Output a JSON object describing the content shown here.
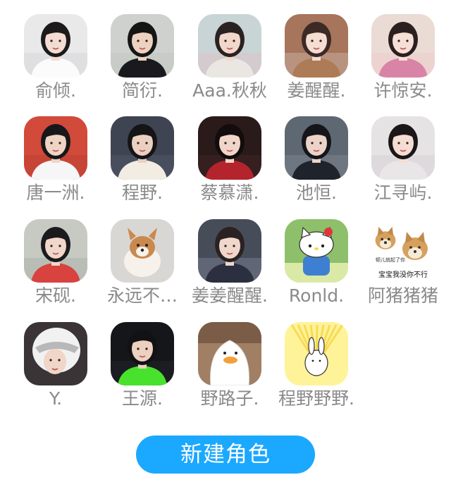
{
  "roles": [
    {
      "name": "俞倾.",
      "avatar": {
        "bg": "#e9e9ea",
        "skin": "#f3dcd2",
        "hair": "#1c1a1b",
        "cloth": "#fbfbfb",
        "accent": "#cfcfd2"
      }
    },
    {
      "name": "简衍.",
      "avatar": {
        "bg": "#cfd1cf",
        "skin": "#ecd2bf",
        "hair": "#151515",
        "cloth": "#1a1a1e",
        "accent": "#b7c2b8"
      }
    },
    {
      "name": "Aaa.秋秋",
      "avatar": {
        "bg": "#c9d4d6",
        "skin": "#f1d8cb",
        "hair": "#2a2221",
        "cloth": "#eae7e2",
        "accent": "#e9b9c0"
      }
    },
    {
      "name": "姜醒醒.",
      "avatar": {
        "bg": "#a7745c",
        "skin": "#f5ddd1",
        "hair": "#3b2a25",
        "cloth": "#ad7b56",
        "accent": "#d9cfc4"
      }
    },
    {
      "name": "许惊安.",
      "avatar": {
        "bg": "#eadbd5",
        "skin": "#f6dfd6",
        "hair": "#2b1f1f",
        "cloth": "#d984a6",
        "accent": "#f2c7c9"
      }
    },
    {
      "name": "唐一洲.",
      "avatar": {
        "bg": "#d24a3a",
        "skin": "#efd4c3",
        "hair": "#18171a",
        "cloth": "#f6f6f6",
        "accent": "#b43b30"
      }
    },
    {
      "name": "程野.",
      "avatar": {
        "bg": "#3f4452",
        "skin": "#ebd0c1",
        "hair": "#151417",
        "cloth": "#f2ece2",
        "accent": "#5a6276"
      }
    },
    {
      "name": "蔡慕潇.",
      "avatar": {
        "bg": "#2a1a1a",
        "skin": "#f0d5c8",
        "hair": "#120c0c",
        "cloth": "#b3242d",
        "accent": "#4a2b2b"
      }
    },
    {
      "name": "池恒.",
      "avatar": {
        "bg": "#5e6873",
        "skin": "#ecd3c7",
        "hair": "#15151a",
        "cloth": "#1f232b",
        "accent": "#8a939c"
      }
    },
    {
      "name": "江寻屿.",
      "avatar": {
        "bg": "#e6e3e5",
        "skin": "#f5ddd3",
        "hair": "#1b1617",
        "cloth": "#e8e6e7",
        "accent": "#cbc7cb"
      }
    },
    {
      "name": "宋砚.",
      "avatar": {
        "bg": "#c7cac3",
        "skin": "#f0d7c9",
        "hair": "#1b1a1c",
        "cloth": "#d8423f",
        "accent": "#9fa79a"
      }
    },
    {
      "name": "永远不…",
      "avatar": {
        "bg": "#d9d7d4",
        "skin": "#c9894f",
        "hair": "#f6f1ea",
        "cloth": "#e7e4e0",
        "accent": "#a8a6a3"
      }
    },
    {
      "name": "姜姜醒醒.",
      "avatar": {
        "bg": "#474c59",
        "skin": "#f0d7cc",
        "hair": "#2a2222",
        "cloth": "#2b2f3f",
        "accent": "#8e98ad"
      }
    },
    {
      "name": "Ronld.",
      "avatar": {
        "bg": "#8ebf6a",
        "skin": "#ffffff",
        "hair": "#e5333b",
        "cloth": "#3f7fd1",
        "accent": "#f3d94a"
      }
    },
    {
      "name": "阿猪猪猪",
      "avatar": {
        "bg": "#ffffff",
        "skin": "#d6a15e",
        "hair": "#f4ead9",
        "cloth": "#3a2a1c",
        "accent": "#c18a4a"
      }
    },
    {
      "name": "Y.",
      "avatar": {
        "bg": "#3a3436",
        "skin": "#f0d6c6",
        "hair": "#f1f1f1",
        "cloth": "#242022",
        "accent": "#d8d8d8"
      }
    },
    {
      "name": "王源.",
      "avatar": {
        "bg": "#15161a",
        "skin": "#edd0bf",
        "hair": "#121214",
        "cloth": "#48e22d",
        "accent": "#2a2c33"
      }
    },
    {
      "name": "野路子.",
      "avatar": {
        "bg": "#a07f65",
        "skin": "#ffffff",
        "hair": "#f2a13a",
        "cloth": "#f4f4f4",
        "accent": "#7b5c47"
      }
    },
    {
      "name": "程野野野.",
      "avatar": {
        "bg": "#fff39a",
        "skin": "#ffffff",
        "hair": "#f7d443",
        "cloth": "#ffffff",
        "accent": "#f5c531"
      }
    }
  ],
  "sticker_text": "宝宝我没你不行",
  "sticker_subtext": "顿儿就起了你",
  "create_button": "新建角色",
  "colors": {
    "label": "#8a8a8a",
    "button_bg": "#1ba8ff",
    "button_text": "#ffffff",
    "page_bg": "#ffffff"
  }
}
